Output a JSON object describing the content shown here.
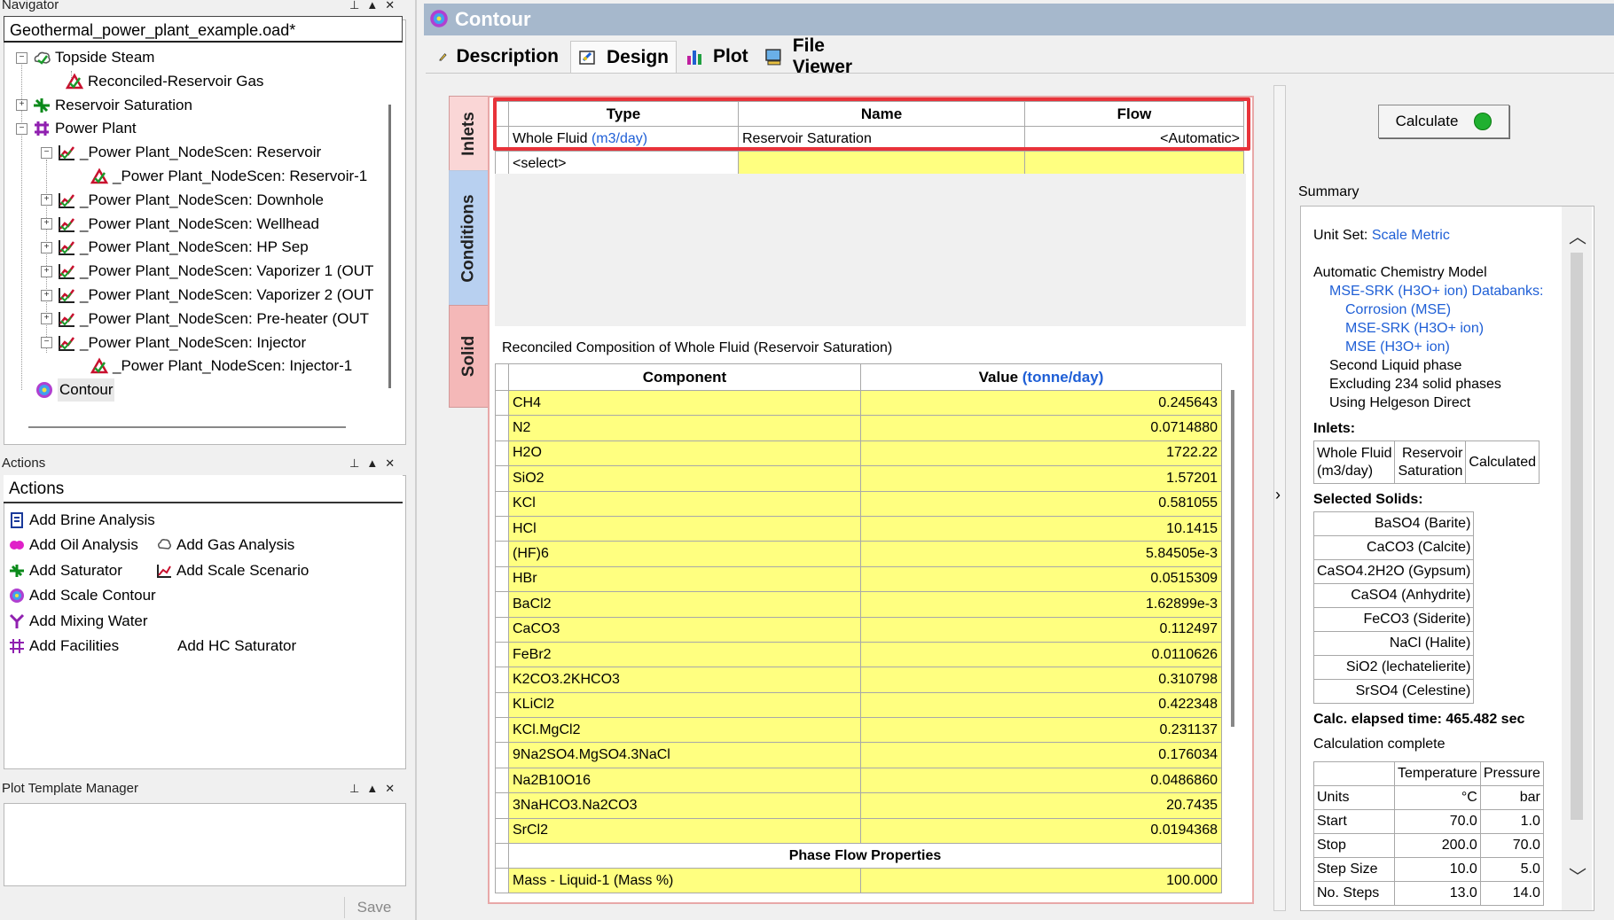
{
  "navigator": {
    "title": "Navigator",
    "file": "Geothermal_power_plant_example.oad*",
    "items": [
      {
        "label": "Topside Steam"
      },
      {
        "label": "Reconciled-Reservoir Gas"
      },
      {
        "label": "Reservoir Saturation"
      },
      {
        "label": "Power Plant"
      },
      {
        "label": "_Power Plant_NodeScen: Reservoir"
      },
      {
        "label": "_Power Plant_NodeScen: Reservoir-1"
      },
      {
        "label": "_Power Plant_NodeScen: Downhole"
      },
      {
        "label": "_Power Plant_NodeScen: Wellhead"
      },
      {
        "label": "_Power Plant_NodeScen: HP Sep"
      },
      {
        "label": "_Power Plant_NodeScen: Vaporizer 1 (OUT"
      },
      {
        "label": "_Power Plant_NodeScen: Vaporizer 2 (OUT"
      },
      {
        "label": "_Power Plant_NodeScen: Pre-heater (OUT"
      },
      {
        "label": "_Power Plant_NodeScen: Injector"
      },
      {
        "label": "_Power Plant_NodeScen: Injector-1"
      },
      {
        "label": "Contour"
      }
    ]
  },
  "actions": {
    "title": "Actions",
    "header": "Actions",
    "items": [
      {
        "label": "Add Brine Analysis"
      },
      {
        "label": "Add Oil Analysis"
      },
      {
        "label": "Add Gas Analysis"
      },
      {
        "label": "Add Saturator"
      },
      {
        "label": "Add Scale Scenario"
      },
      {
        "label": "Add Scale Contour"
      },
      {
        "label": "Add Mixing Water"
      },
      {
        "label": "Add Facilities"
      },
      {
        "label": "Add HC Saturator"
      }
    ]
  },
  "plot_template": {
    "title": "Plot Template Manager",
    "save": "Save"
  },
  "main": {
    "title": "Contour",
    "tabs": [
      {
        "label": "Description"
      },
      {
        "label": "Design"
      },
      {
        "label": "Plot"
      },
      {
        "label": "File Viewer"
      }
    ],
    "side_tabs": [
      "Inlets",
      "Conditions",
      "Solid"
    ],
    "inlets": {
      "headers": [
        "Type",
        "Name",
        "Flow"
      ],
      "row": {
        "type": "Whole Fluid",
        "unit": "(m3/day)",
        "name": "Reservoir Saturation",
        "flow": "<Automatic>"
      },
      "select": "<select>"
    },
    "composition": {
      "title": "Reconciled Composition of Whole Fluid (Reservoir Saturation)",
      "header_component": "Component",
      "header_value": "Value",
      "header_unit": "(tonne/day)",
      "rows": [
        {
          "c": "CH4",
          "v": "0.245643"
        },
        {
          "c": "N2",
          "v": "0.0714880"
        },
        {
          "c": "H2O",
          "v": "1722.22"
        },
        {
          "c": "SiO2",
          "v": "1.57201"
        },
        {
          "c": "KCl",
          "v": "0.581055"
        },
        {
          "c": "HCl",
          "v": "10.1415"
        },
        {
          "c": "(HF)6",
          "v": "5.84505e-3"
        },
        {
          "c": "HBr",
          "v": "0.0515309"
        },
        {
          "c": "BaCl2",
          "v": "1.62899e-3"
        },
        {
          "c": "CaCO3",
          "v": "0.112497"
        },
        {
          "c": "FeBr2",
          "v": "0.0110626"
        },
        {
          "c": "K2CO3.2KHCO3",
          "v": "0.310798"
        },
        {
          "c": "KLiCl2",
          "v": "0.422348"
        },
        {
          "c": "KCl.MgCl2",
          "v": "0.231137"
        },
        {
          "c": "9Na2SO4.MgSO4.3NaCl",
          "v": "0.176034"
        },
        {
          "c": "Na2B10O16",
          "v": "0.0486860"
        },
        {
          "c": "3NaHCO3.Na2CO3",
          "v": "20.7435"
        },
        {
          "c": "SrCl2",
          "v": "0.0194368"
        }
      ],
      "phase_header": "Phase Flow Properties",
      "phase_row": {
        "c": "Mass - Liquid-1 (Mass %)",
        "v": "100.000"
      }
    }
  },
  "calculate": "Calculate",
  "summary": {
    "title": "Summary",
    "unit_set_label": "Unit Set:",
    "unit_set_value": "Scale Metric",
    "model": "Automatic Chemistry Model",
    "databank": "MSE-SRK (H3O+ ion) Databanks:",
    "db1": "Corrosion (MSE)",
    "db2": "MSE-SRK (H3O+ ion)",
    "db3": "MSE (H3O+ ion)",
    "second_liquid": "Second Liquid phase",
    "excluding": "Excluding 234 solid phases",
    "helgeson": "Using Helgeson Direct",
    "inlets_label": "Inlets:",
    "inlet_type": "Whole Fluid",
    "inlet_unit": "(m3/day)",
    "inlet_name1": "Reservoir",
    "inlet_name2": "Saturation",
    "inlet_flow": "Calculated",
    "solids_label": "Selected Solids:",
    "solids": [
      "BaSO4 (Barite)",
      "CaCO3 (Calcite)",
      "CaSO4.2H2O (Gypsum)",
      "CaSO4 (Anhydrite)",
      "FeCO3 (Siderite)",
      "NaCl (Halite)",
      "SiO2 (lechatelierite)",
      "SrSO4 (Celestine)"
    ],
    "elapsed": "Calc. elapsed time: 465.482 sec",
    "complete": "Calculation complete",
    "cond_headers": [
      "",
      "Temperature",
      "Pressure"
    ],
    "cond_rows": [
      [
        "Units",
        "°C",
        "bar"
      ],
      [
        "Start",
        "70.0",
        "1.0"
      ],
      [
        "Stop",
        "200.0",
        "70.0"
      ],
      [
        "Step Size",
        "10.0",
        "5.0"
      ],
      [
        "No. Steps",
        "13.0",
        "14.0"
      ]
    ]
  },
  "colors": {
    "accent_red": "#e8333a",
    "grid_yellow": "#ffff80",
    "link_blue": "#1f5fd6",
    "title_bar": "#a6b8cc"
  }
}
